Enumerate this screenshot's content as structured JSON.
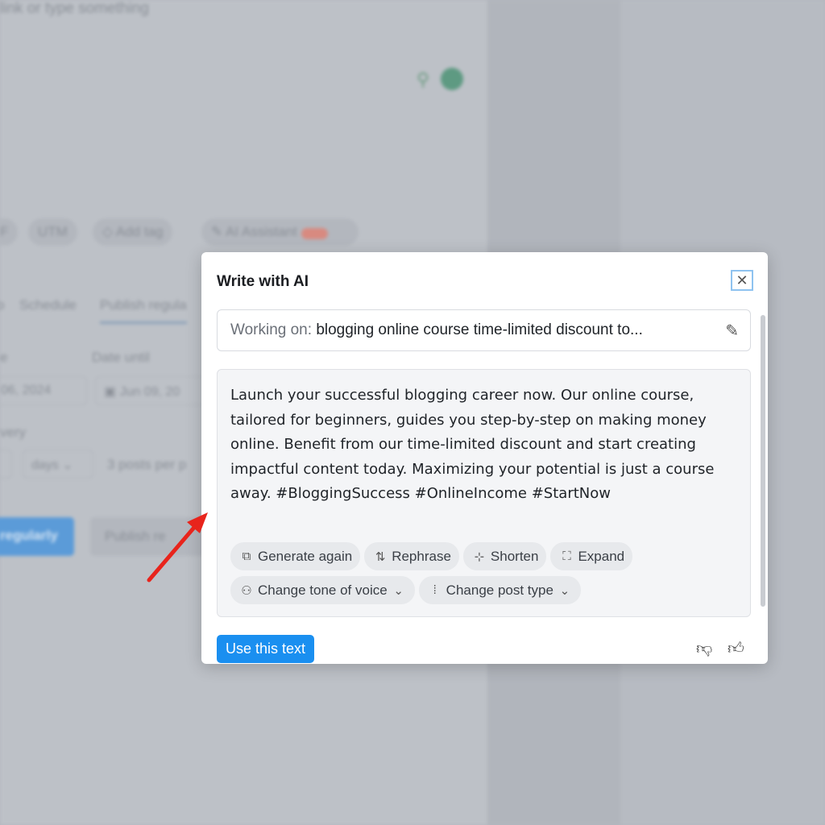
{
  "background": {
    "editor_placeholder": "link or type something",
    "toolbar": [
      "F",
      "UTM",
      "Add tag",
      "AI Assistant"
    ],
    "beta_badge": "beta",
    "tabs": [
      "o",
      "Schedule",
      "Publish regula"
    ],
    "date_from_label": "e",
    "date_from": "06, 2024",
    "date_until_label": "Date until",
    "date_until": "Jun 09, 20",
    "every_label": "very",
    "period": "days",
    "posts_per": "3 posts per p",
    "primary_button": "regularly",
    "secondary_button": "Publish re"
  },
  "modal": {
    "title": "Write with AI",
    "working_label": "Working on:",
    "working_value": "blogging online course time-limited discount to...",
    "generated_text": "Launch your successful blogging career now. Our online course, tailored for beginners, guides you step-by-step on making money online. Benefit from our time-limited discount and start creating impactful content today. Maximizing your potential is just a course away. #BloggingSuccess #OnlineIncome #StartNow",
    "actions": [
      {
        "label": "Generate again",
        "icon": "regenerate-icon"
      },
      {
        "label": "Rephrase",
        "icon": "rephrase-icon"
      },
      {
        "label": "Shorten",
        "icon": "shorten-icon"
      },
      {
        "label": "Expand",
        "icon": "expand-icon"
      },
      {
        "label": "Change tone of voice",
        "icon": "voice-icon"
      },
      {
        "label": "Change post type",
        "icon": "post-type-icon"
      }
    ],
    "use_button": "Use this text",
    "accent": "#1a8ff0"
  }
}
